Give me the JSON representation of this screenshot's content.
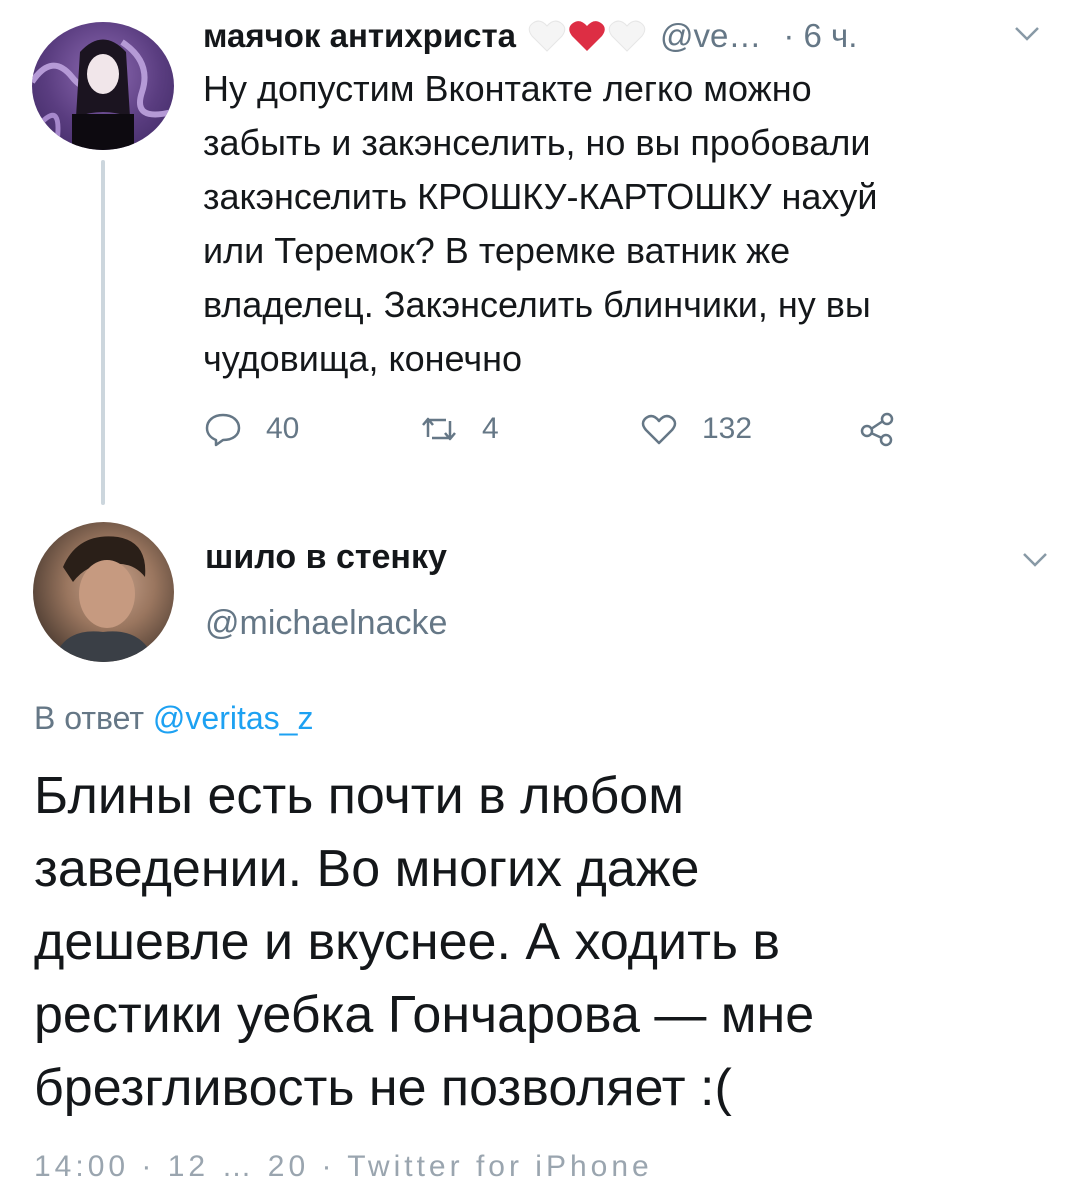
{
  "parent_tweet": {
    "display_name": "маячок антихриста",
    "name_emoji": [
      "white-heart",
      "red-heart",
      "white-heart"
    ],
    "handle": "@ve…",
    "time": "· 6 ч.",
    "text": "Ну допустим Вконтакте легко можно\nзабыть и закэнселить, но вы пробовали\nзакэнселить КРОШКУ-КАРТОШКУ нахуй\nили Теремок? В теремке ватник же\nвладелец. Закэнселить блинчики, ну вы\nчудовища, конечно",
    "actions": {
      "reply_count": "40",
      "retweet_count": "4",
      "like_count": "132"
    }
  },
  "reply_tweet": {
    "display_name": "шило в стенку",
    "handle": "@michaelnacke",
    "in_reply_prefix": "В ответ ",
    "in_reply_mention": "@veritas_z",
    "text": "Блины есть почти в любом\nзаведении. Во многих даже\nдешевле и вкуснее. А ходить в\nрестики уебка Гончарова — мне\nбрезгливость не позволяет :(",
    "footer_cut": "14:00 · 12 …  20 · Twitter for iPhone"
  },
  "colors": {
    "text_primary": "#14171a",
    "text_secondary": "#657786",
    "link": "#1da1f2",
    "heart_red": "#e0245e",
    "thread_line": "#ccd6dd"
  },
  "icons": [
    "reply-icon",
    "retweet-icon",
    "like-icon",
    "share-icon",
    "chevron-down-icon"
  ]
}
